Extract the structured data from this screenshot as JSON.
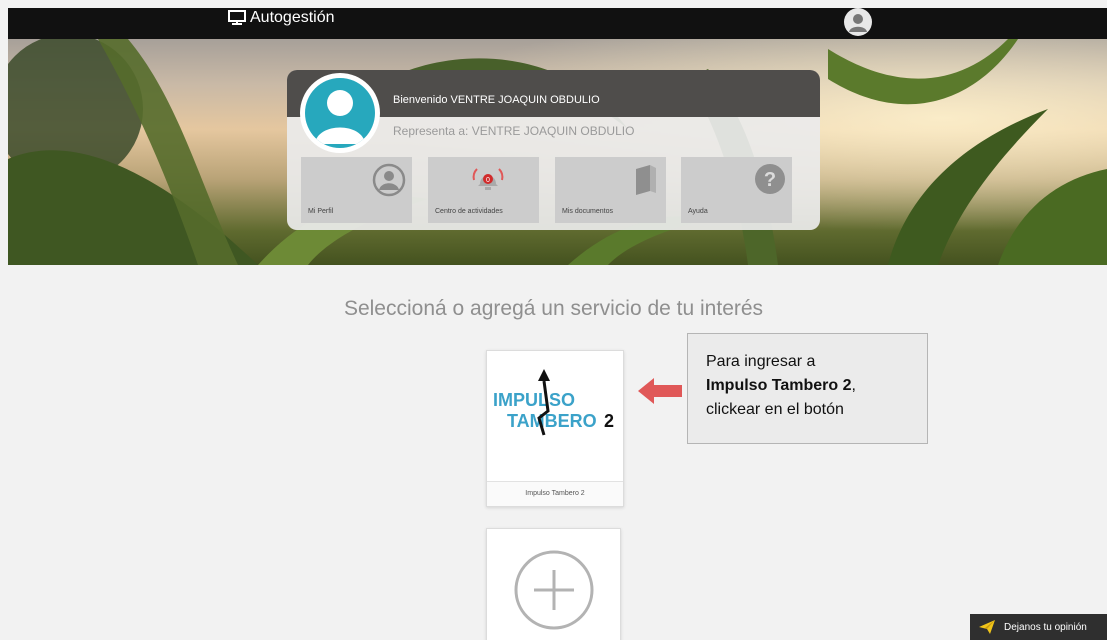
{
  "topbar": {
    "brand_label": "Autogestión"
  },
  "card": {
    "welcome_text": "Bienvenido VENTRE JOAQUIN OBDULIO",
    "represents_text": "Representa a: VENTRE JOAQUIN OBDULIO",
    "tiles": [
      {
        "label": "Mi Perfil",
        "icon": "user-circle-icon"
      },
      {
        "label": "Centro de actividades",
        "icon": "alarm-bell-icon",
        "badge": "0"
      },
      {
        "label": "Mis documentos",
        "icon": "book-icon"
      },
      {
        "label": "Ayuda",
        "icon": "help-circle-icon"
      }
    ]
  },
  "main": {
    "headline": "Seleccioná o agregá un servicio de tu interés",
    "service": {
      "name": "Impulso Tambero 2",
      "logo_line1": "IMPULSO",
      "logo_line2": "TAMBERO",
      "logo_number": "2"
    },
    "callout": {
      "line1": "Para ingresar a",
      "bold": "Impulso Tambero 2",
      "comma": ",",
      "line3": "clickear en el botón"
    }
  },
  "feedback": {
    "label": "Dejanos tu opinión"
  },
  "colors": {
    "accent_teal": "#27a8bd",
    "logo_blue": "#3ba2c9",
    "arrow_red": "#e05858",
    "topbar": "#111111"
  }
}
